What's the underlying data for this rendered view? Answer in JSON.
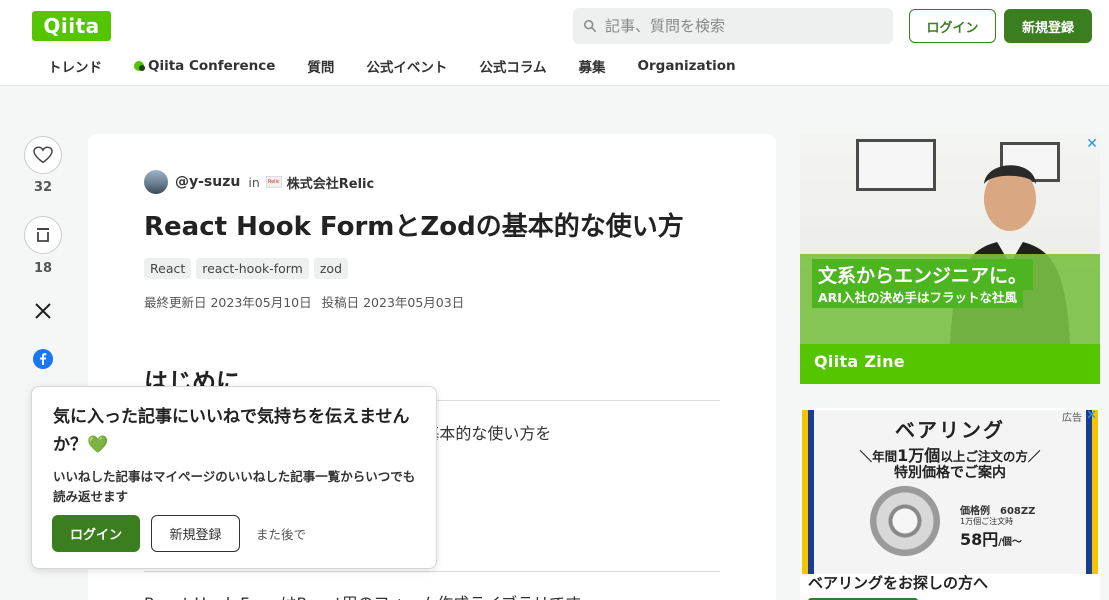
{
  "header": {
    "logo": "Qiita",
    "search_placeholder": "記事、質問を検索",
    "login_label": "ログイン",
    "signup_label": "新規登録",
    "nav": [
      "トレンド",
      "Qiita Conference",
      "質問",
      "公式イベント",
      "公式コラム",
      "募集",
      "Organization"
    ]
  },
  "actions": {
    "like_count": "32",
    "stock_count": "18"
  },
  "article": {
    "author": "@y-suzu",
    "in_label": "in",
    "org": "株式会社Relic",
    "title": "React Hook FormとZodの基本的な使い方",
    "tags": [
      "React",
      "react-hook-form",
      "zod"
    ],
    "updated": "最終更新日 2023年05月10日",
    "posted": "投稿日 2023年05月03日",
    "heading": "はじめに",
    "para1": "Hook FormとZodの基本的な使い方を",
    "para2": "React Hook FormはReact用のフォーム作成ライブラリです"
  },
  "popup": {
    "title": "気に入った記事にいいねで気持ちを伝えませんか？",
    "heart": "💚",
    "desc": "いいねした記事はマイページのいいねした記事一覧からいつでも読み返せます",
    "login_label": "ログイン",
    "signup_label": "新規登録",
    "later_label": "また後で"
  },
  "ad1": {
    "headline": "文系からエンジニアに。",
    "subhead": "ARI入社の決め手はフラットな社風",
    "footer": "Qiita Zine",
    "close": "✕"
  },
  "ad2": {
    "label": "広告",
    "close": "✕",
    "title": "ベアリング",
    "line1_pre": "＼年間",
    "line1_big": "1万個",
    "line1_post": "以上ご注文の方／",
    "line2": "特別価格でご案内",
    "price_label": "価格例　608ZZ",
    "price_sub": "1万個ご注文時",
    "price": "58円",
    "price_unit": "/個〜",
    "caption": "ベアリングをお探しの方へ"
  },
  "colors": {
    "brand": "#55c500",
    "primary_button": "#3a7e1f"
  }
}
